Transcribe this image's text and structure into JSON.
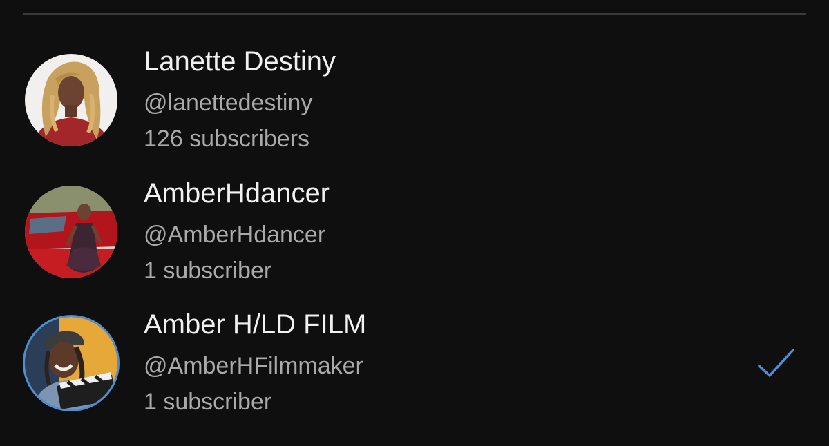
{
  "accounts": [
    {
      "display_name": "Lanette Destiny",
      "handle": "@lanettedestiny",
      "subscribers": "126 subscribers",
      "avatar_icon": "avatar-photo",
      "selected": false
    },
    {
      "display_name": "AmberHdancer",
      "handle": "@AmberHdancer",
      "subscribers": "1 subscriber",
      "avatar_icon": "avatar-photo",
      "selected": false
    },
    {
      "display_name": "Amber H/LD FILM",
      "handle": "@AmberHFilmmaker",
      "subscribers": "1 subscriber",
      "avatar_icon": "avatar-photo",
      "selected": true
    }
  ],
  "colors": {
    "background": "#0f0f0f",
    "primary_text": "#f1f1f1",
    "secondary_text": "#aaaaaa",
    "accent": "#4d8fd6",
    "divider": "#3a3a3a"
  },
  "icons": {
    "selected": "checkmark-icon"
  }
}
